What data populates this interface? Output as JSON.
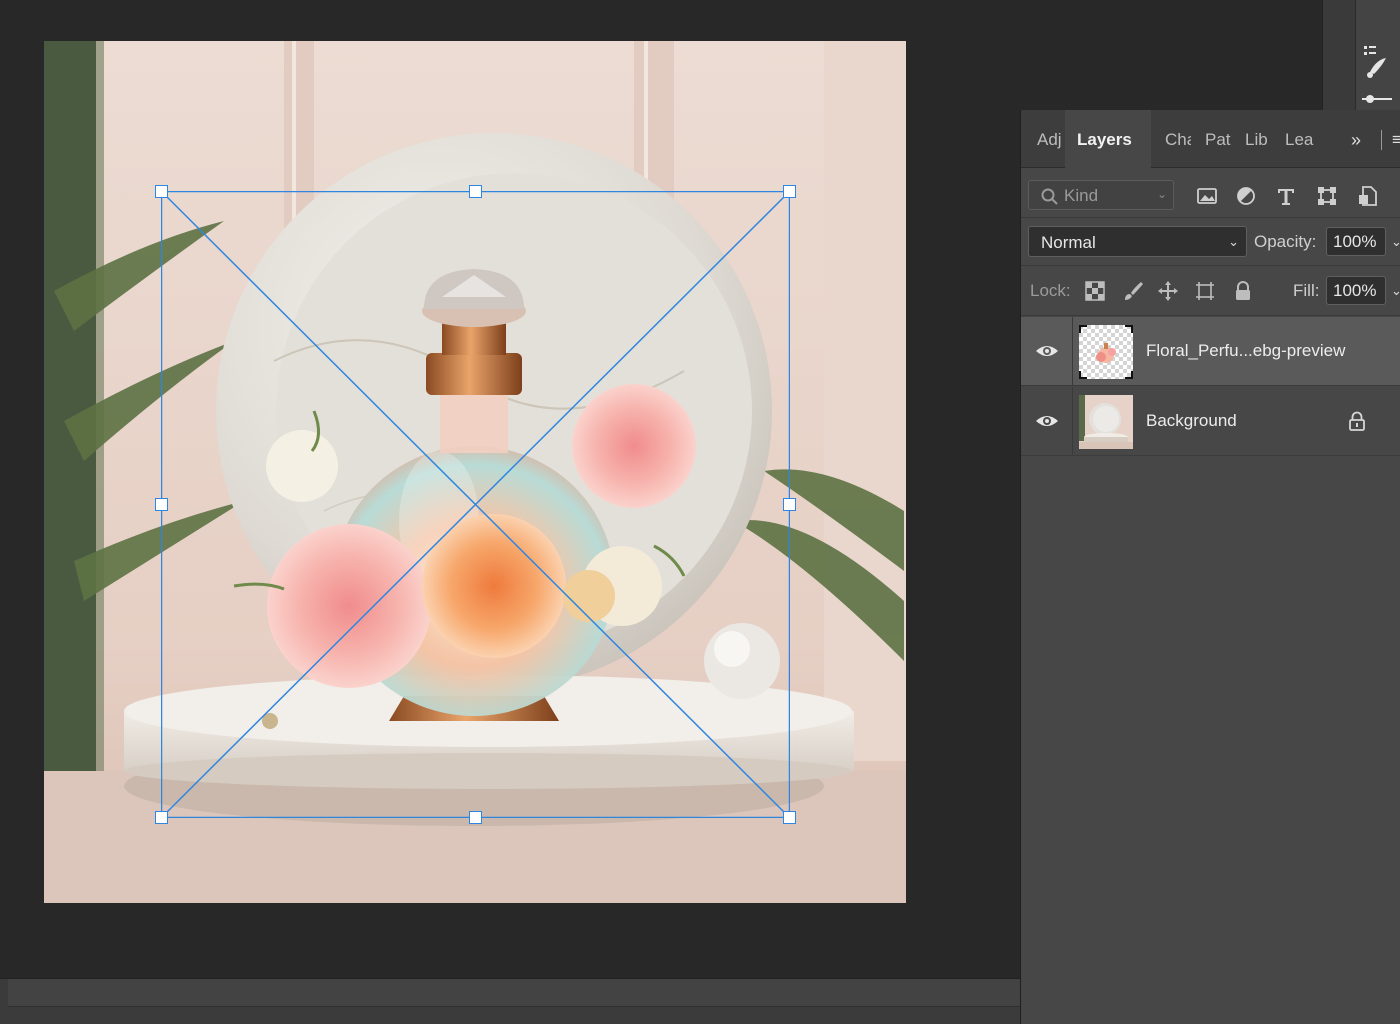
{
  "document": {
    "artwork": "Floral perfume bottle on marble pedestal product mockup"
  },
  "transform": {
    "mode": "free-transform",
    "handle_color": "#2f86e0"
  },
  "layers_panel": {
    "tabs": [
      {
        "label": "Adj",
        "active": false
      },
      {
        "label": "Layers",
        "active": true
      },
      {
        "label": "Cha",
        "active": false
      },
      {
        "label": "Pat",
        "active": false
      },
      {
        "label": "Lib",
        "active": false
      },
      {
        "label": "Lea",
        "active": false
      }
    ],
    "more_icon": "double-chevron-right-icon",
    "menu_icon": "panel-menu-icon",
    "filter": {
      "placeholder": "Kind",
      "icons": [
        "image-filter-icon",
        "adjustment-filter-icon",
        "type-filter-icon",
        "shape-filter-icon",
        "smart-object-filter-icon"
      ]
    },
    "blend_mode": "Normal",
    "opacity_label": "Opacity:",
    "opacity_value": "100%",
    "lock_label": "Lock:",
    "lock_icons": [
      "lock-transparent-icon",
      "lock-pixels-icon",
      "lock-position-icon",
      "lock-artboard-icon",
      "lock-all-icon"
    ],
    "fill_label": "Fill:",
    "fill_value": "100%",
    "layers": [
      {
        "name": "Floral_Perfu...ebg-preview",
        "visible": true,
        "selected": true,
        "locked": false
      },
      {
        "name": "Background",
        "visible": true,
        "selected": false,
        "locked": true
      }
    ]
  },
  "colors": {
    "app_bg": "#282828",
    "panel_bg": "#474747",
    "selected_row": "#5a5a5a",
    "accent": "#2f86e0"
  }
}
